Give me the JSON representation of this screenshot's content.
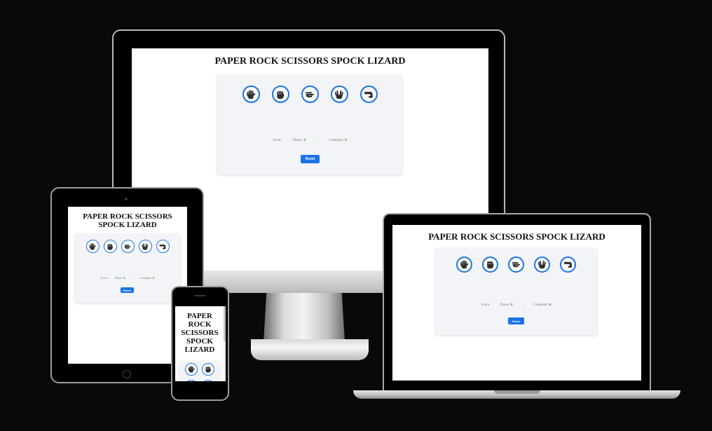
{
  "app": {
    "title": "PAPER ROCK SCISSORS SPOCK LIZARD",
    "choices": [
      {
        "name": "paper",
        "icon": "hand-paper-icon"
      },
      {
        "name": "rock",
        "icon": "hand-rock-icon"
      },
      {
        "name": "scissors",
        "icon": "hand-scissors-icon"
      },
      {
        "name": "spock",
        "icon": "hand-spock-icon"
      },
      {
        "name": "lizard",
        "icon": "hand-lizard-icon"
      }
    ],
    "score_label": "Score:",
    "player_label": "Player:",
    "player_score": "0",
    "separator": "-",
    "computer_label": "Computer:",
    "computer_score": "0",
    "reset_label": "Reset"
  },
  "colors": {
    "background": "#090909",
    "accent": "#1a73e8",
    "panel": "#f3f4f7",
    "player_score": "#1f9d3a",
    "computer_score": "#e0302b"
  }
}
